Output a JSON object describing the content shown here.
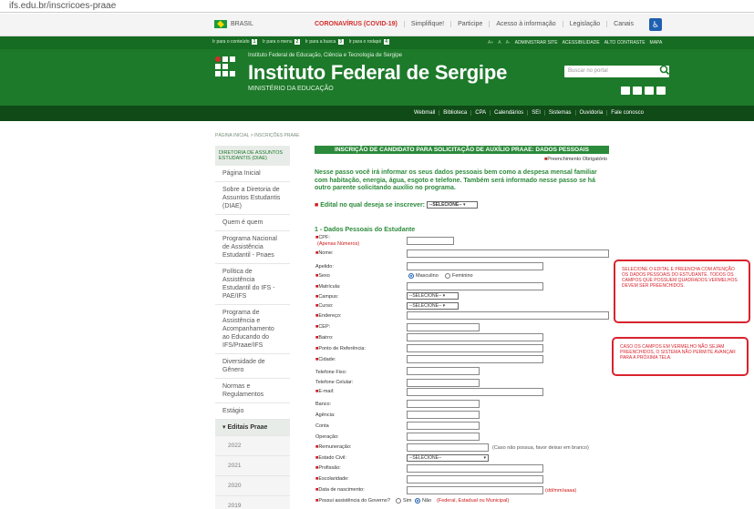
{
  "browser": {
    "url": "ifs.edu.br/inscricoes-praae"
  },
  "gov_bar": {
    "brasil": "BRASIL",
    "links": [
      "CORONAVÍRUS (COVID-19)",
      "Simplifique!",
      "Participe",
      "Acesso à informação",
      "Legislação",
      "Canais"
    ]
  },
  "header": {
    "skip_links": [
      "Ir para o conteúdo",
      "Ir para o menu",
      "Ir para a busca",
      "Ir para o rodapé"
    ],
    "skip_keys": [
      "1",
      "2",
      "3",
      "4"
    ],
    "toolbar": [
      "A+",
      "A",
      "A-",
      "ADMINISTRAR SITE",
      "ACESSIBILIDADE",
      "ALTO CONTRASTE",
      "MAPA"
    ],
    "subtitle": "Instituto Federal de Educação, Ciência e Tecnologia de Sergipe",
    "title": "Instituto Federal de Sergipe",
    "ministry": "MINISTÉRIO DA EDUCAÇÃO",
    "search_placeholder": "Buscar no portal"
  },
  "nav": [
    "Webmail",
    "Biblioteca",
    "CPA",
    "Calendários",
    "SEI",
    "Sistemas",
    "Ouvidoria",
    "Fale conosco"
  ],
  "breadcrumb": "PÁGINA INICIAL > INSCRIÇÕES PRAAE",
  "sidebar": {
    "heading": "DIRETORIA DE ASSUNTOS ESTUDANTIS (DIAE)",
    "items": [
      "Página Inicial",
      "Sobre a Diretoria de Assuntos Estudantis (DIAE)",
      "Quem é quem",
      "Programa Nacional de Assistência Estudantil - Pnaes",
      "Política de Assistência Estudantil do IFS - PAE/IFS",
      "Programa de Assistência e Acompanhamento ao Educando do IFS/Praae/IFS",
      "Diversidade de Gênero",
      "Normas e Regulamentos",
      "Estágio"
    ],
    "section": "Editais Praae",
    "years": [
      "2022",
      "2021",
      "2020",
      "2019"
    ]
  },
  "form": {
    "title": "INSCRIÇÃO DE CANDIDATO PARA SOLICITAÇÃO DE AUXÍLIO PRAAE: DADOS PESSOAIS",
    "required_note": "Preenchimento Obrigatório",
    "intro": "Nesse passo você irá informar os seus dados pessoais bem como a despesa mensal familiar com habitação, energia, água, esgoto e telefone. Também será informado nesse passo se há outro parente solicitando auxílio no programa.",
    "edital_label": "Edital no qual deseja se inscrever:",
    "select_default": "--SELECIONE--",
    "section_title": "1 - Dados Pessoais do Estudante",
    "cpf_hint": "(Apenas Números)",
    "labels": {
      "cpf": "CPF:",
      "nome": "Nome:",
      "apelido": "Apelido:",
      "sexo": "Sexo",
      "matricula": "Matrícula:",
      "campus": "Campus:",
      "curso": "Curso:",
      "endereco": "Endereço:",
      "cep": "CEP:",
      "bairro": "Bairro:",
      "referencia": "Ponto de Referência:",
      "cidade": "Cidade:",
      "tel_fixo": "Telefone Fixo:",
      "tel_celular": "Telefone Celular:",
      "email": "E-mail:",
      "banco": "Banco:",
      "agencia": "Agência:",
      "conta": "Conta",
      "operacao": "Operação:",
      "remuneracao": "Remuneração:",
      "estado_civil": "Estado Civil:",
      "profissao": "Profissão:",
      "escolaridade": "Escolaridade:",
      "nascimento": "Data de nascimento:",
      "governo": "Possui assistência do Governo?"
    },
    "sexo_options": [
      "Masculino",
      "Feminino"
    ],
    "remuneracao_hint": "(Caso não possua, favor deixar em branco)",
    "date_hint": "(dd/mm/aaaa)",
    "gov_options": [
      "Sim",
      "Não"
    ],
    "gov_hint": "(Federal, Estadual ou Municipal)"
  },
  "callouts": [
    "SELECIONE O EDITAL E PREENCHA COM ATENÇÃO OS DADOS PESSOAIS DO ESTUDANTE. TODOS OS CAMPOS QUE POSSUEM QUADRADOS VERMELHOS DEVEM SER PREENCHIDOS.",
    "CASO OS CAMPOS EM VERMELHO NÃO SEJAM PREENCHIDOS, O SISTEMA NÃO PERMITE AVANÇAR PARA A PRÓXIMA TELA."
  ],
  "colors": {
    "ifs_green": "#1d7a2a",
    "nav_dark": "#0f4a17",
    "required_red": "#d01616",
    "callout_red": "#d9232e"
  }
}
